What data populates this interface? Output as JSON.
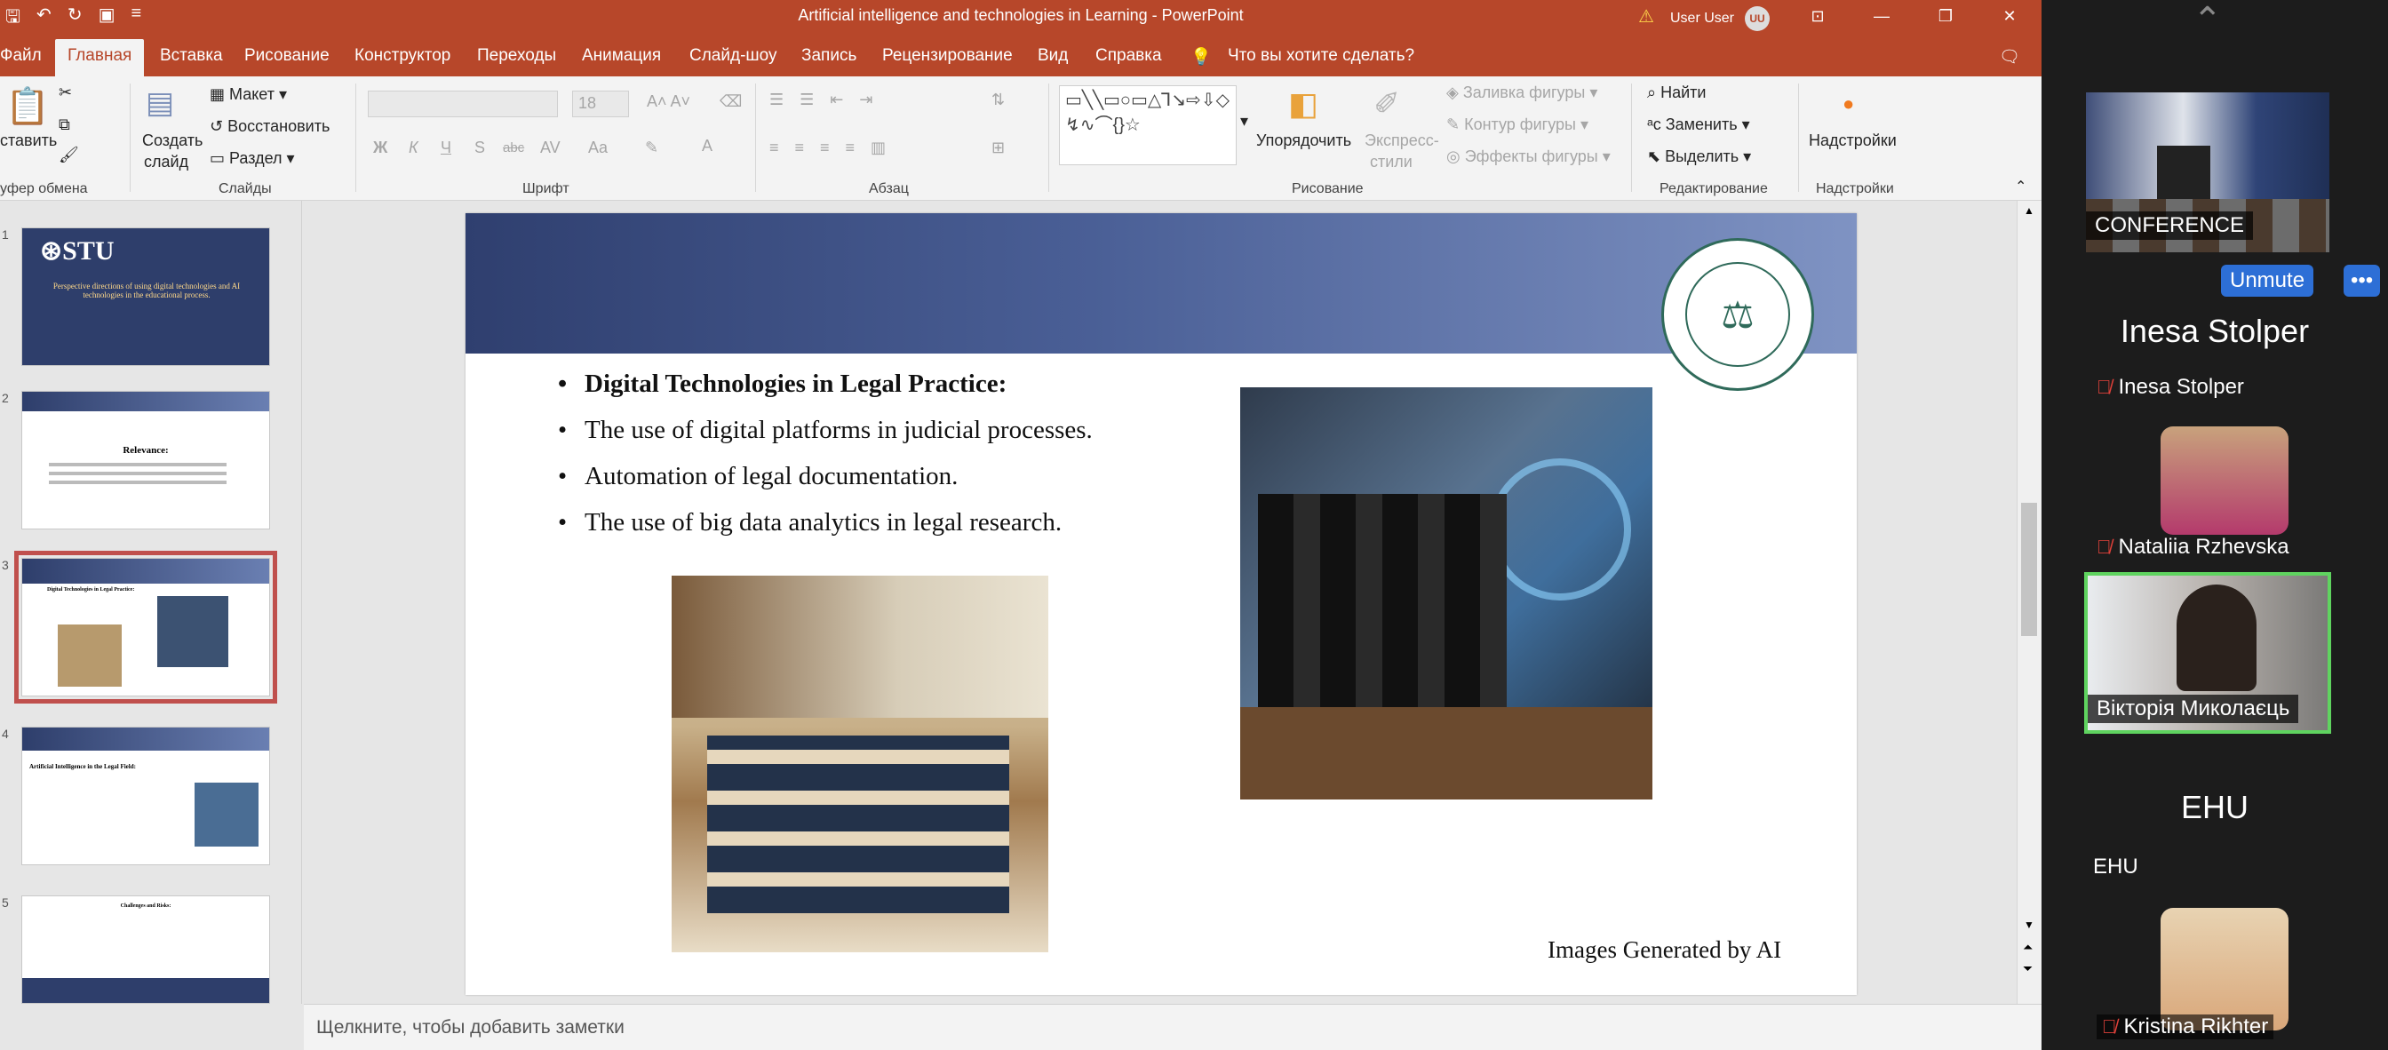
{
  "window": {
    "title": "Artificial intelligence and technologies in Learning  -  PowerPoint",
    "user": "User User",
    "user_initials": "UU"
  },
  "ribbon_tabs": [
    "Файл",
    "Главная",
    "Вставка",
    "Рисование",
    "Конструктор",
    "Переходы",
    "Анимация",
    "Слайд-шоу",
    "Запись",
    "Рецензирование",
    "Вид",
    "Справка"
  ],
  "tell_me": "Что вы хотите сделать?",
  "ribbon": {
    "clipboard": {
      "paste": "ставить",
      "label": "уфер обмена"
    },
    "slides": {
      "new_slide_1": "Создать",
      "new_slide_2": "слайд",
      "layout": "Макет",
      "reset": "Восстановить",
      "section": "Раздел",
      "label": "Слайды"
    },
    "font": {
      "size": "18",
      "label": "Шрифт",
      "bold": "Ж",
      "italic": "К",
      "underline": "Ч",
      "shadow": "S",
      "strike": "abc",
      "spacing": "AV",
      "case": "Aa"
    },
    "paragraph": {
      "label": "Абзац"
    },
    "drawing": {
      "arrange": "Упорядочить",
      "quick_styles_1": "Экспресс-",
      "quick_styles_2": "стили",
      "fill": "Заливка фигуры",
      "outline": "Контур фигуры",
      "effects": "Эффекты фигуры",
      "label": "Рисование"
    },
    "editing": {
      "find": "Найти",
      "replace": "Заменить",
      "select": "Выделить",
      "label": "Редактирование"
    },
    "addins": {
      "button": "Надстройки",
      "label": "Надстройки"
    }
  },
  "thumbnails": [
    {
      "num": "1",
      "title": "Perspective directions of using digital technologies and AI technologies in the educational process."
    },
    {
      "num": "2",
      "title": "Relevance:"
    },
    {
      "num": "3",
      "title": "Digital Technologies in Legal Practice:"
    },
    {
      "num": "4",
      "title": "Artificial Intelligence in the Legal Field:"
    },
    {
      "num": "5",
      "title": "Challenges and Risks:"
    }
  ],
  "slide": {
    "bullets": [
      "Digital Technologies in Legal Practice:",
      "The use of digital platforms in judicial processes.",
      "Automation of legal documentation.",
      "The use of big data analytics in legal research."
    ],
    "caption": "Images Generated by AI"
  },
  "notes_placeholder": "Щелкните, чтобы добавить заметки",
  "meeting": {
    "conference_label": "CONFERENCE",
    "unmute": "Unmute",
    "more": "•••",
    "participants": [
      {
        "big": "Inesa Stolper",
        "name": "Inesa Stolper"
      },
      {
        "name": "Nataliia Rzhevska"
      },
      {
        "name": "Вікторія Миколаєць"
      },
      {
        "big": "EHU",
        "name": "EHU"
      },
      {
        "name": "Kristina Rikhter"
      }
    ]
  }
}
